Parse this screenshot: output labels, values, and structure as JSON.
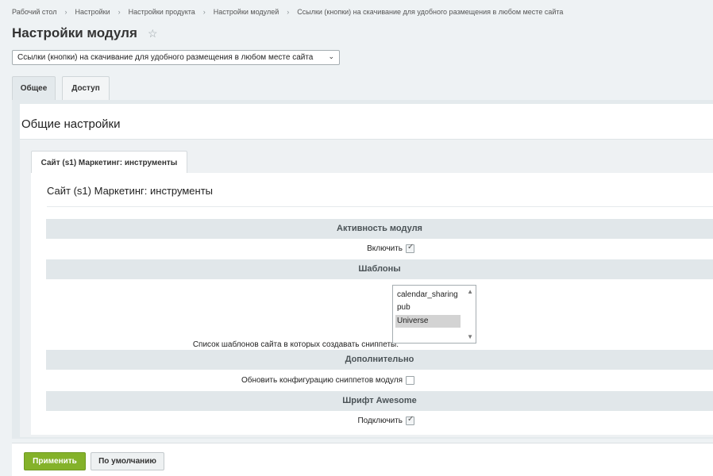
{
  "breadcrumb": [
    "Рабочий стол",
    "Настройки",
    "Настройки продукта",
    "Настройки модулей",
    "Ссылки (кнопки) на скачивание для удобного размещения в любом месте сайта"
  ],
  "breadcrumb_separator": "›",
  "page_title": "Настройки модуля",
  "star_icon": "☆",
  "module_select": {
    "value": "Ссылки (кнопки) на скачивание для удобного размещения в любом месте сайта",
    "chevron": "⌄"
  },
  "tabs": [
    {
      "label": "Общее",
      "active": true
    },
    {
      "label": "Доступ",
      "active": false
    }
  ],
  "section_title": "Общие настройки",
  "site_tab": {
    "label": "Сайт (s1) Маркетинг: инструменты",
    "title": "Сайт (s1) Маркетинг: инструменты"
  },
  "groups": {
    "activity": {
      "header": "Активность модуля",
      "enable_label": "Включить",
      "enable_checked": true
    },
    "templates": {
      "header": "Шаблоны",
      "list_label": "Список шаблонов сайта в которых создавать сниппеты:",
      "options": [
        "calendar_sharing",
        "pub",
        "Universe"
      ],
      "selected": "Universe"
    },
    "additional": {
      "header": "Дополнительно",
      "update_label": "Обновить конфигурацию сниппетов модуля",
      "update_checked": false
    },
    "font": {
      "header": "Шрифт Awesome",
      "connect_label": "Подключить",
      "connect_checked": true
    }
  },
  "footer": {
    "apply_label": "Применить",
    "default_label": "По умолчанию"
  },
  "colors": {
    "apply_button": "#84b22a",
    "group_header_bg": "#e1e7ea",
    "page_bg": "#eef2f4"
  }
}
